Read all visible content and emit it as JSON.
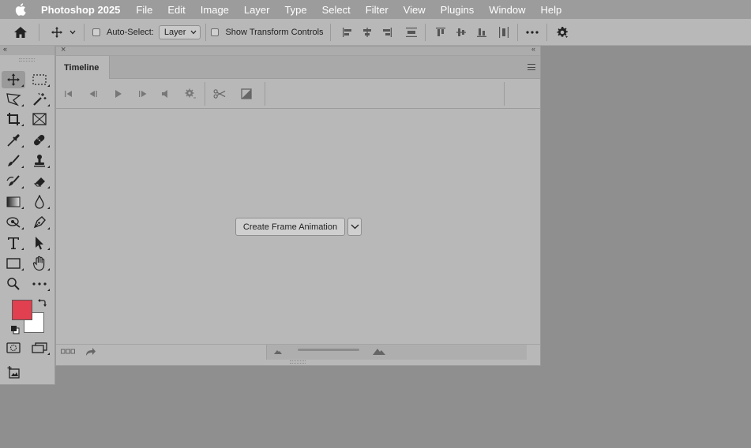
{
  "menubar": {
    "app_name": "Photoshop 2025",
    "items": [
      "File",
      "Edit",
      "Image",
      "Layer",
      "Type",
      "Select",
      "Filter",
      "View",
      "Plugins",
      "Window",
      "Help"
    ]
  },
  "options_bar": {
    "auto_select_label": "Auto-Select:",
    "auto_select_checked": false,
    "auto_select_target": "Layer",
    "show_transform_label": "Show Transform Controls",
    "show_transform_checked": false
  },
  "tools_panel": {
    "tools": [
      "move-tool",
      "marquee-tool",
      "lasso-tool",
      "magic-wand-tool",
      "crop-tool",
      "frame-tool",
      "eyedropper-tool",
      "healing-brush-tool",
      "brush-tool",
      "clone-stamp-tool",
      "history-brush-tool",
      "eraser-tool",
      "gradient-tool",
      "blur-tool",
      "dodge-tool",
      "pen-tool",
      "type-tool",
      "path-selection-tool",
      "rectangle-tool",
      "hand-tool",
      "zoom-tool",
      "more-tools"
    ],
    "foreground_color": "#e0404f",
    "background_color": "#ffffff"
  },
  "timeline": {
    "tab_label": "Timeline",
    "create_button_label": "Create Frame Animation"
  },
  "colors": {
    "canvas_bg": "#8f8f8f",
    "panel_bg": "#b8b8b8",
    "menubar_bg": "#9c9c9c"
  }
}
